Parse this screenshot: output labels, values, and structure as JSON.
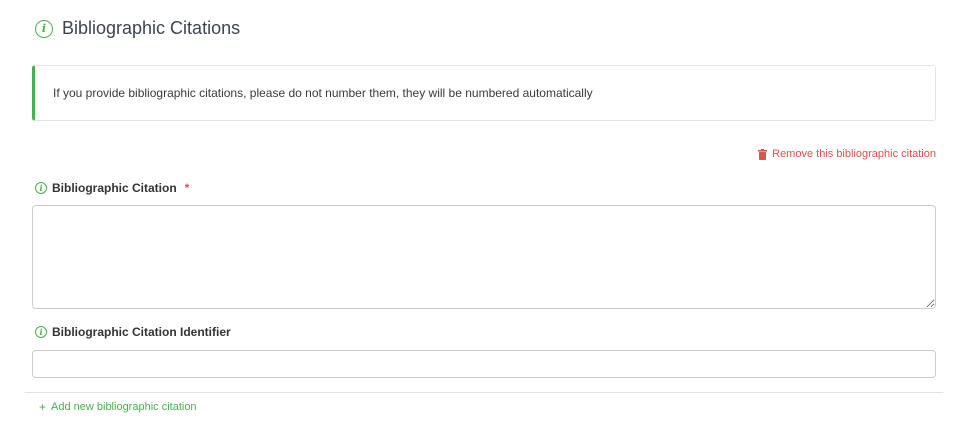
{
  "section": {
    "title": "Bibliographic Citations",
    "icon": "info-icon"
  },
  "notice": {
    "text": "If you provide bibliographic citations, please do not number them, they will be numbered automatically"
  },
  "actions": {
    "remove_label": "Remove this bibliographic citation",
    "remove_icon": "trash-icon",
    "add_label": "Add new bibliographic citation",
    "add_icon": "plus-icon"
  },
  "fields": {
    "citation": {
      "label": "Bibliographic Citation",
      "required_mark": "*",
      "value": "",
      "placeholder": ""
    },
    "identifier": {
      "label": "Bibliographic Citation Identifier",
      "value": "",
      "placeholder": ""
    }
  },
  "colors": {
    "accent": "#4caf50",
    "danger": "#d9534f",
    "border": "#cccccc"
  }
}
